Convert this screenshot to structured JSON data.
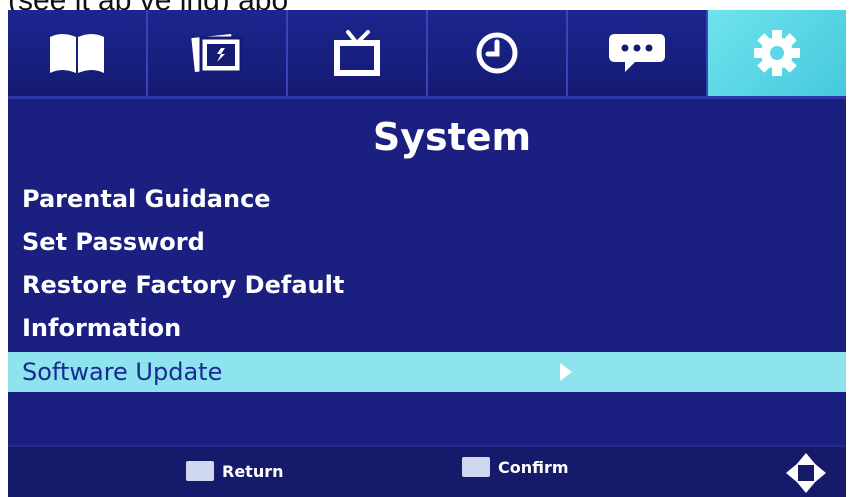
{
  "caption": "(see  it  ab  ve  ing)  abo",
  "tabs": [
    {
      "icon": "book-icon",
      "active": false
    },
    {
      "icon": "picture-icon",
      "active": false
    },
    {
      "icon": "tv-icon",
      "active": false
    },
    {
      "icon": "clock-icon",
      "active": false
    },
    {
      "icon": "speech-bubble-icon",
      "active": false
    },
    {
      "icon": "gear-icon",
      "active": true
    }
  ],
  "title": "System",
  "menu": {
    "items": [
      {
        "label": "Parental Guidance"
      },
      {
        "label": "Set Password"
      },
      {
        "label": "Restore Factory Default"
      },
      {
        "label": "Information"
      },
      {
        "label": "Software Update",
        "selected": true
      }
    ]
  },
  "footer": {
    "return_label": "Return",
    "confirm_label": "Confirm"
  },
  "colors": {
    "background": "#1a1f80",
    "active_tab": "#6fe3ee",
    "selected_row": "#8ee4ee",
    "selected_text": "#1a2a90"
  }
}
